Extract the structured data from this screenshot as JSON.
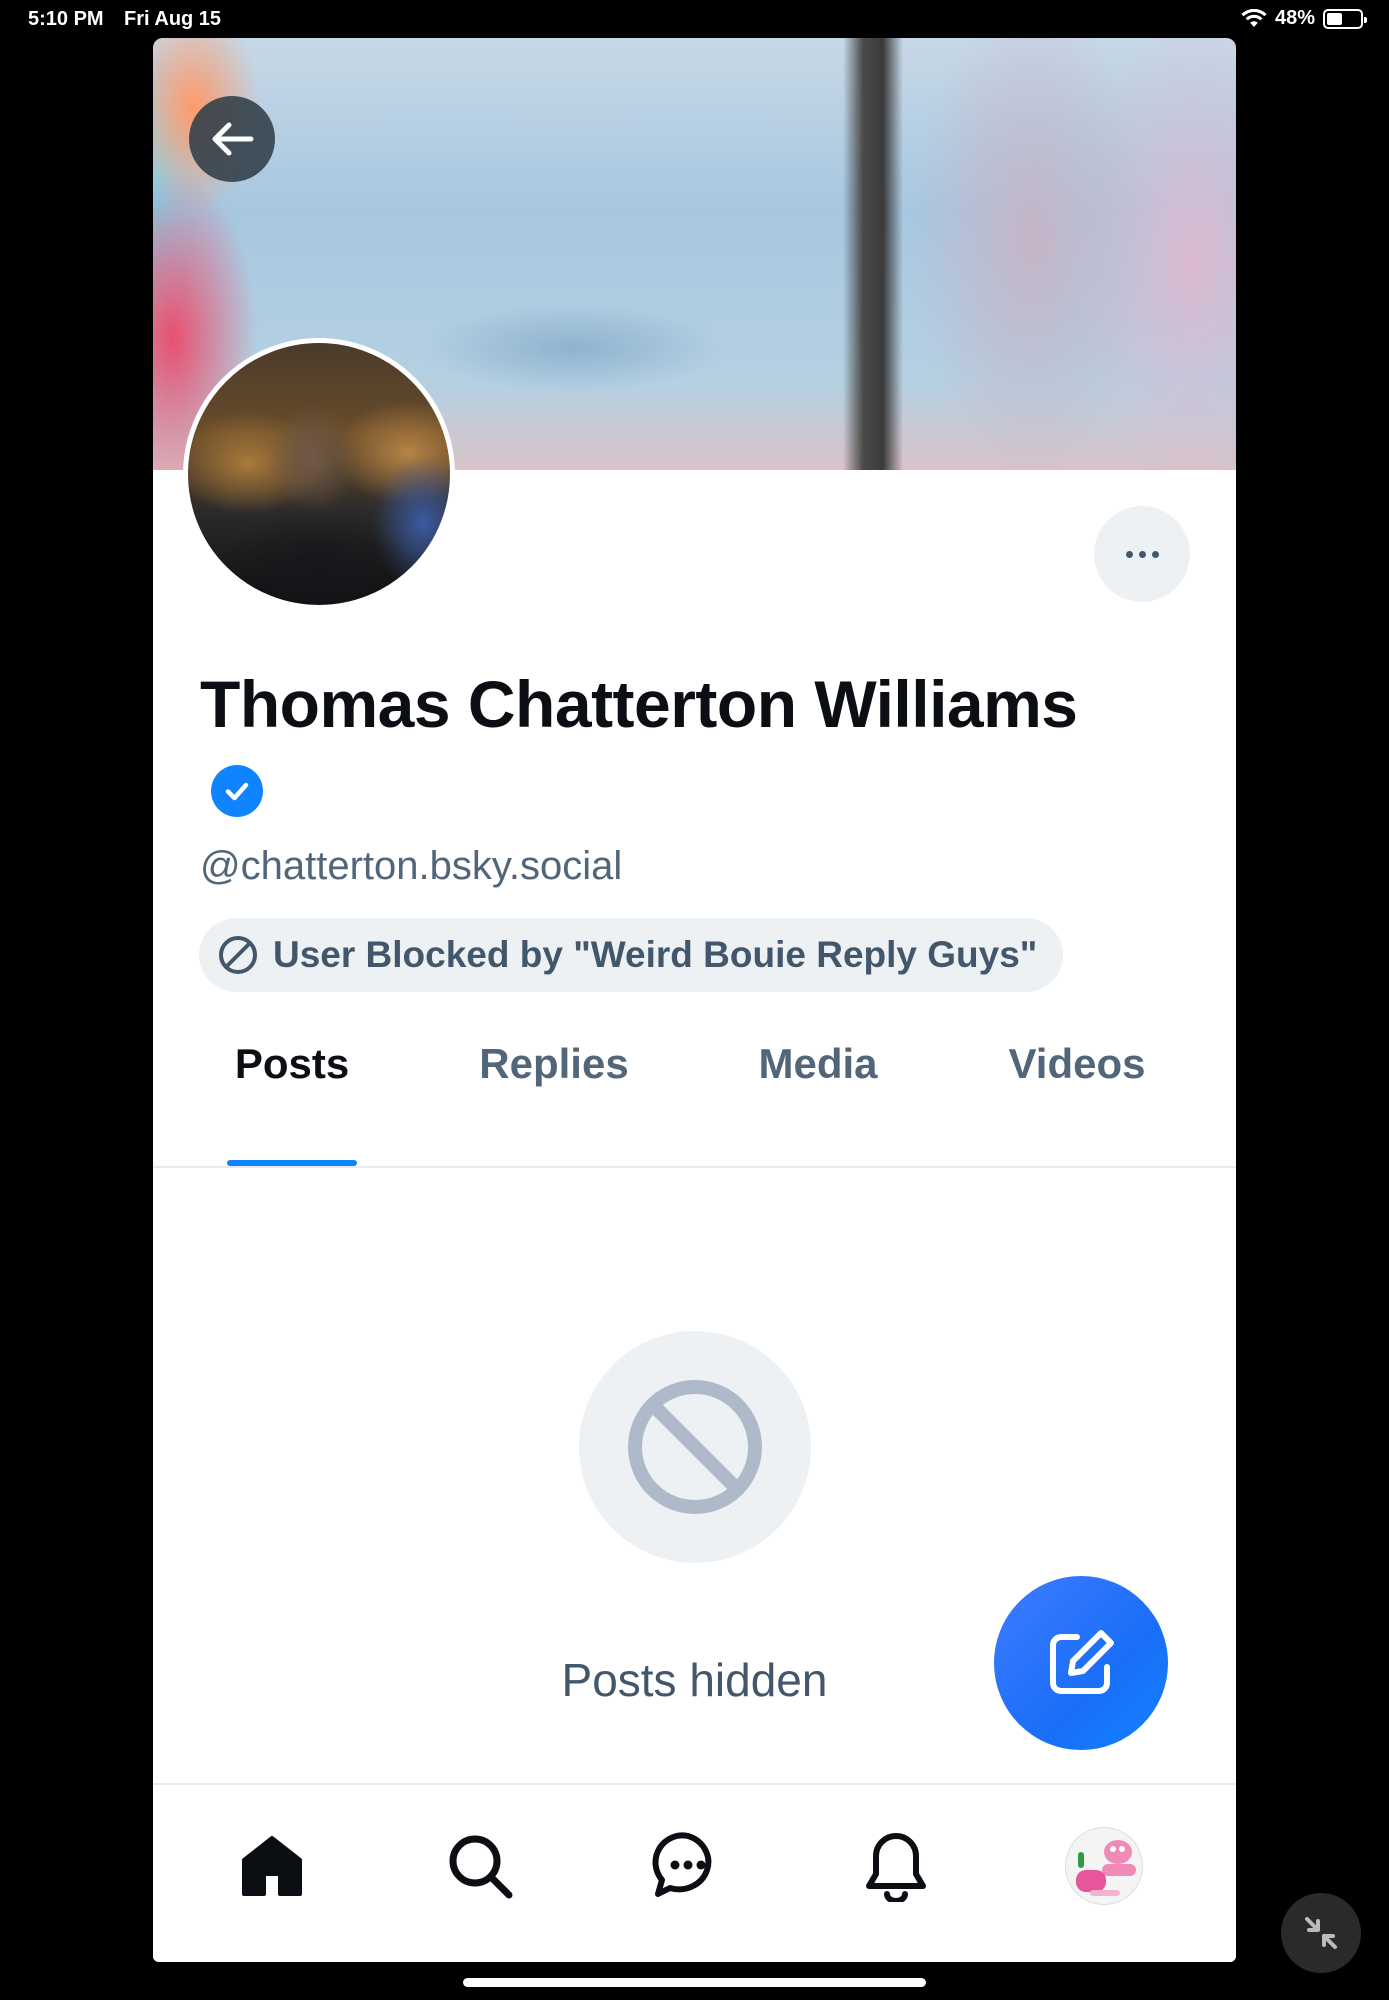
{
  "status_bar": {
    "time": "5:10 PM",
    "date": "Fri Aug 15",
    "battery_text": "48%",
    "battery_level": 0.48,
    "wifi_icon": "wifi-icon"
  },
  "profile": {
    "display_name": "Thomas Chatterton Williams",
    "handle": "@chatterton.bsky.social",
    "verified": true,
    "blocked_label": "User Blocked by \"Weird Bouie Reply Guys\""
  },
  "tabs": [
    {
      "label": "Posts",
      "active": true
    },
    {
      "label": "Replies",
      "active": false
    },
    {
      "label": "Media",
      "active": false
    },
    {
      "label": "Videos",
      "active": false
    }
  ],
  "empty_state": {
    "icon": "blocked-circle-icon",
    "message": "Posts hidden"
  },
  "bottom_nav": {
    "items": [
      "home-icon",
      "search-icon",
      "chat-icon",
      "bell-icon",
      "profile-avatar"
    ]
  },
  "colors": {
    "accent": "#1083fe",
    "muted_text": "#52667a",
    "pill_bg": "#eef1f4"
  }
}
